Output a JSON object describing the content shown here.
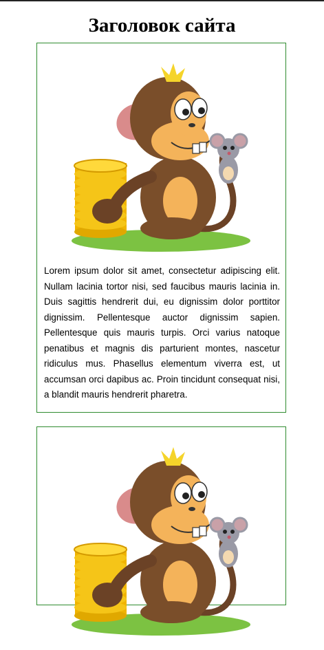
{
  "header": {
    "title": "Заголовок сайта"
  },
  "cards": [
    {
      "image": "monkey-with-coins-and-mouse",
      "text": "Lorem ipsum dolor sit amet, consectetur adipiscing elit. Nullam lacinia tortor nisi, sed faucibus mauris lacinia in. Duis sagittis hendrerit dui, eu dignissim dolor porttitor dignissim. Pellentesque auctor dignissim sapien. Pellentesque quis mauris turpis. Orci varius natoque penatibus et magnis dis parturient montes, nascetur ridiculus mus. Phasellus elementum viverra est, ut accumsan orci dapibus ac. Proin tincidunt consequat nisi, a blandit mauris hendrerit pharetra."
    },
    {
      "image": "monkey-with-coins-and-mouse"
    }
  ],
  "colors": {
    "card_border": "#2e8b2e",
    "monkey_fur": "#7a4e2a",
    "monkey_face": "#f4b35a",
    "coins": "#f5c518",
    "grass": "#7cc242",
    "mouse": "#9a9aa6"
  }
}
